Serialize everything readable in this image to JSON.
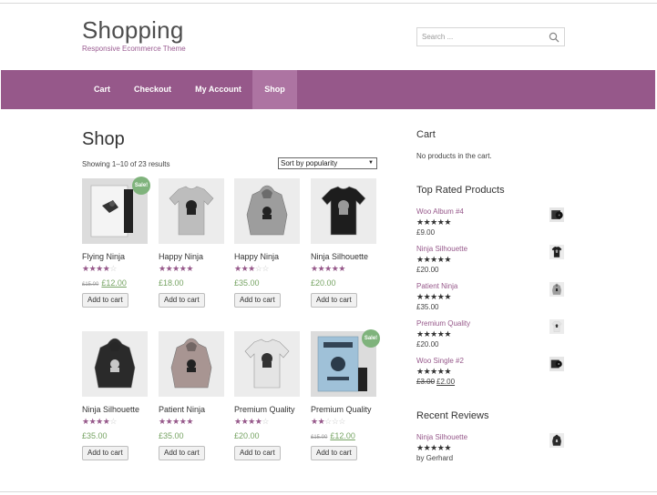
{
  "header": {
    "site_title": "Shopping",
    "tagline": "Responsive Ecommerce Theme",
    "search_placeholder": "Search ..."
  },
  "nav": {
    "items": [
      "Cart",
      "Checkout",
      "My Account",
      "Shop"
    ],
    "active": "Shop"
  },
  "shop": {
    "title": "Shop",
    "result_count": "Showing 1–10 of 23 results",
    "sort_selected": "Sort by popularity",
    "products": [
      {
        "name": "Flying Ninja",
        "rating": 4,
        "old_price": "£15.00",
        "price": "£12.00",
        "sale": "Sale!",
        "button": "Add to cart",
        "image": "poster-ninja"
      },
      {
        "name": "Happy Ninja",
        "rating": 5,
        "old_price": "",
        "price": "£18.00",
        "sale": "",
        "button": "Add to cart",
        "image": "tshirt-grey"
      },
      {
        "name": "Happy Ninja",
        "rating": 3,
        "old_price": "",
        "price": "£35.00",
        "sale": "",
        "button": "Add to cart",
        "image": "hoodie-grey"
      },
      {
        "name": "Ninja Silhouette",
        "rating": 5,
        "old_price": "",
        "price": "£20.00",
        "sale": "",
        "button": "Add to cart",
        "image": "tshirt-black"
      },
      {
        "name": "Ninja Silhouette",
        "rating": 4,
        "old_price": "",
        "price": "£35.00",
        "sale": "",
        "button": "Add to cart",
        "image": "hoodie-black"
      },
      {
        "name": "Patient Ninja",
        "rating": 5,
        "old_price": "",
        "price": "£35.00",
        "sale": "",
        "button": "Add to cart",
        "image": "hoodie-pink"
      },
      {
        "name": "Premium Quality",
        "rating": 4.5,
        "old_price": "",
        "price": "£20.00",
        "sale": "",
        "button": "Add to cart",
        "image": "tshirt-white"
      },
      {
        "name": "Premium Quality",
        "rating": 2,
        "old_price": "£15.00",
        "price": "£12.00",
        "sale": "Sale!",
        "button": "Add to cart",
        "image": "poster-blue"
      }
    ]
  },
  "sidebar": {
    "cart_title": "Cart",
    "cart_empty": "No products in the cart.",
    "top_rated_title": "Top Rated Products",
    "top_rated": [
      {
        "name": "Woo Album #4",
        "rating": 5,
        "old_price": "",
        "price": "£9.00",
        "thumb": "album"
      },
      {
        "name": "Ninja Silhouette",
        "rating": 5,
        "old_price": "",
        "price": "£20.00",
        "thumb": "tshirt-black"
      },
      {
        "name": "Patient Ninja",
        "rating": 5,
        "old_price": "",
        "price": "£35.00",
        "thumb": "hoodie-grey"
      },
      {
        "name": "Premium Quality",
        "rating": 5,
        "old_price": "",
        "price": "£20.00",
        "thumb": "tshirt-white"
      },
      {
        "name": "Woo Single #2",
        "rating": 5,
        "old_price": "£3.00",
        "price": "£2.00",
        "thumb": "single"
      }
    ],
    "recent_reviews_title": "Recent Reviews",
    "recent_reviews": [
      {
        "name": "Ninja Silhouette",
        "rating": 5,
        "author": "by Gerhard",
        "thumb": "hoodie-black"
      }
    ]
  },
  "colors": {
    "brand": "#96588a",
    "nav_active": "#ad74a2",
    "price": "#77a464",
    "sale": "#7fb37c"
  }
}
